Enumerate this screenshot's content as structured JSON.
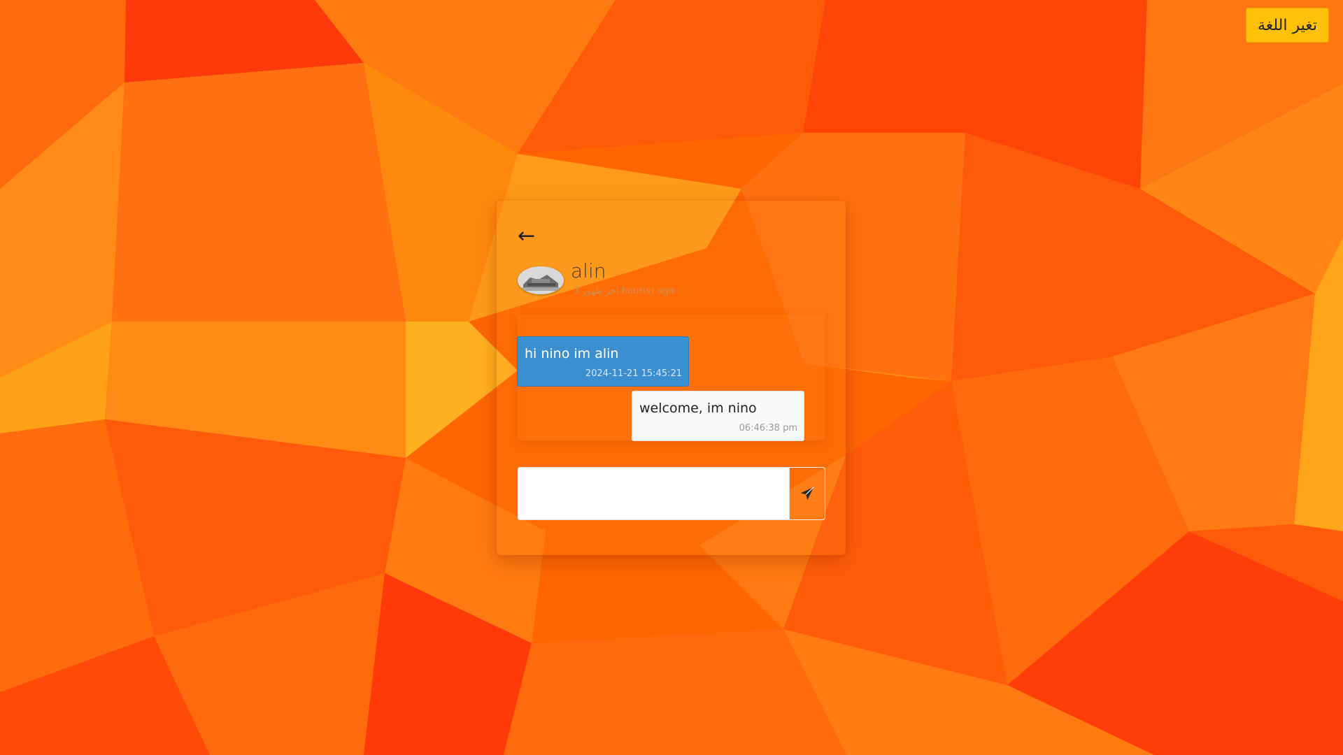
{
  "header": {
    "language_button": "تغير اللغة"
  },
  "contact": {
    "name": "alin",
    "last_seen": "اخر ظهور 3 hour(s) ago"
  },
  "messages": [
    {
      "text": "hi nino im alin",
      "time": "2024-11-21 15:45:21",
      "direction": "sent"
    },
    {
      "text": "welcome, im nino",
      "time": "06:46:38 pm",
      "direction": "received"
    }
  ],
  "composer": {
    "placeholder": ""
  },
  "icons": {
    "back": "left-arrow-icon",
    "send": "paper-plane-icon"
  },
  "colors": {
    "background": "#ff6a00",
    "sent_bubble": "#3b8fd1",
    "received_bubble": "#f8f9fa",
    "language_button": "#ffc107"
  }
}
